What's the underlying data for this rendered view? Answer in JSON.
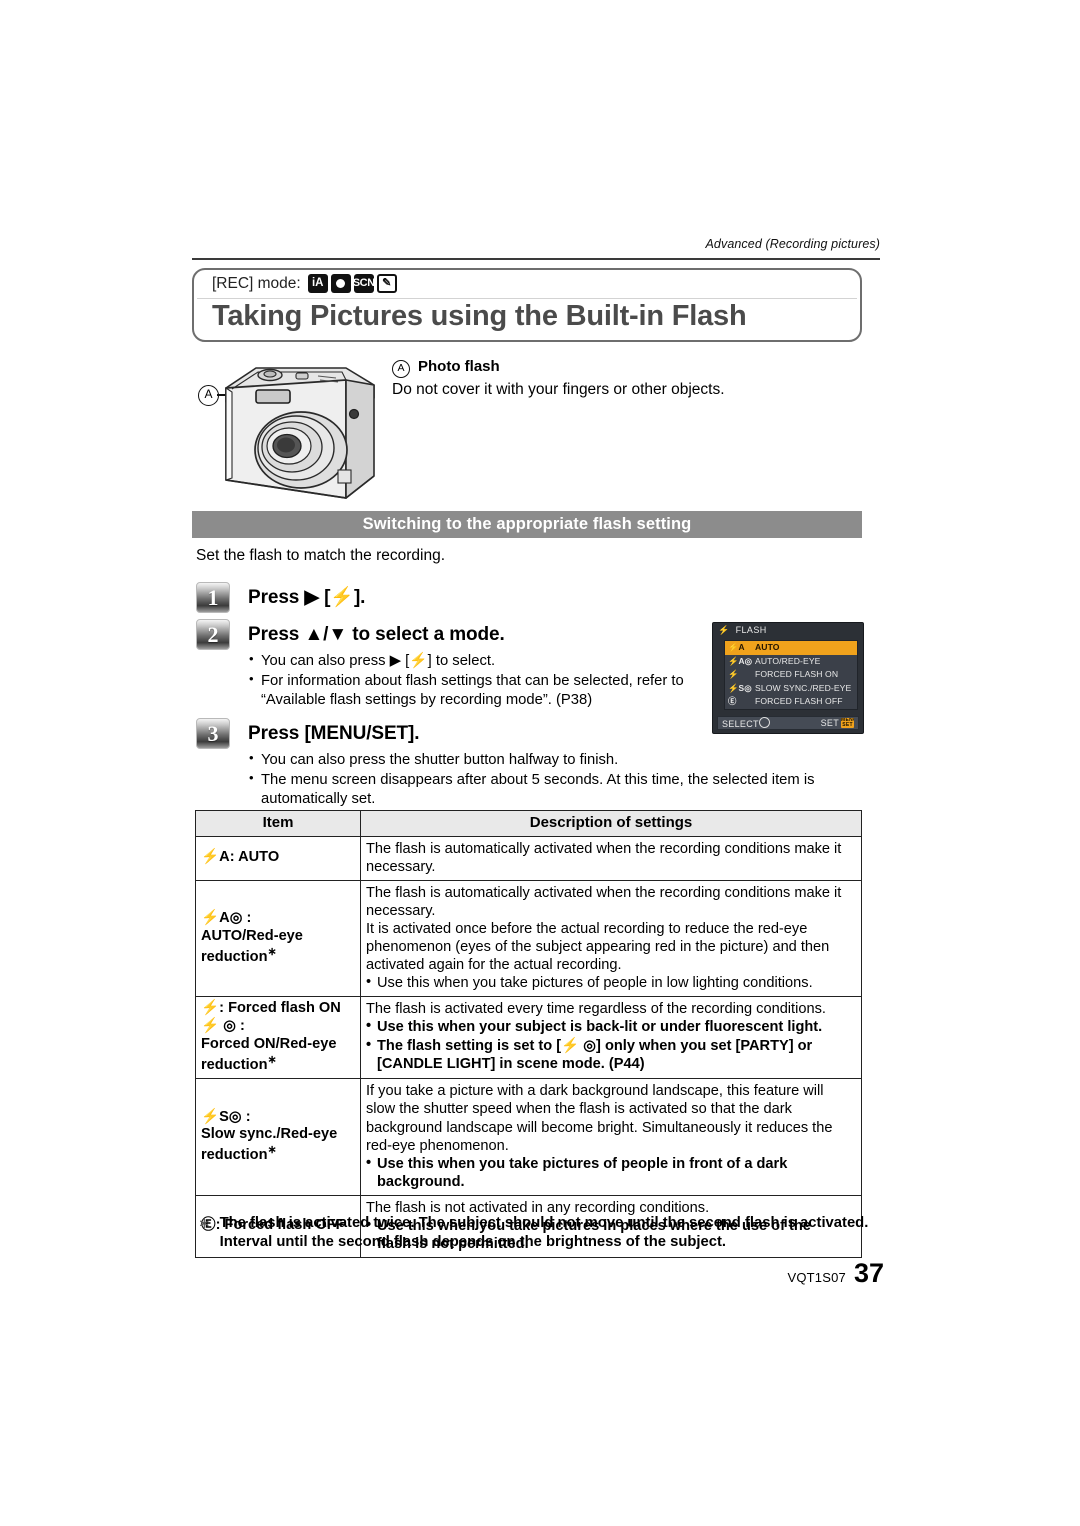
{
  "header": {
    "running_head": "Advanced (Recording pictures)",
    "rec_mode_label": "[REC] mode:",
    "rec_mode_icons": [
      "iA",
      "rec-dot",
      "SCN",
      "custom-note"
    ],
    "title": "Taking Pictures using the Built-in Flash"
  },
  "figure": {
    "callout_letter": "A",
    "caption_marker": "A",
    "caption_title": "Photo flash",
    "caption_body": "Do not cover it with your fingers or other objects."
  },
  "section": {
    "banner": "Switching to the appropriate flash setting",
    "intro": "Set the flash to match the recording."
  },
  "steps": [
    {
      "number": "1",
      "title_pre": "Press ▶ [",
      "title_glyph": "⚡",
      "title_post": "].",
      "bullets": []
    },
    {
      "number": "2",
      "title_pre": "Press ▲/▼ to select a mode.",
      "title_glyph": "",
      "title_post": "",
      "bullets": [
        "You can also press ▶ [⚡] to select.",
        "For information about flash settings that can be selected, refer to",
        "“Available flash settings by recording mode”. (P38)"
      ]
    },
    {
      "number": "3",
      "title_pre": "Press [MENU/SET].",
      "title_glyph": "",
      "title_post": "",
      "bullets": [
        "You can also press the shutter button halfway to finish.",
        "The menu screen disappears after about 5 seconds. At this time, the selected item is",
        "automatically set."
      ]
    }
  ],
  "lcd": {
    "title": "FLASH",
    "title_icon": "⚡",
    "rows": [
      {
        "icon": "⚡A",
        "label": "AUTO",
        "selected": true
      },
      {
        "icon": "⚡A◎",
        "label": "AUTO/RED-EYE",
        "selected": false
      },
      {
        "icon": "⚡",
        "label": "FORCED FLASH ON",
        "selected": false
      },
      {
        "icon": "⚡S◎",
        "label": "SLOW SYNC./RED-EYE",
        "selected": false
      },
      {
        "icon": "Ⓔ",
        "label": "FORCED FLASH OFF",
        "selected": false
      }
    ],
    "footer_left": "SELECT",
    "footer_right": "SET",
    "footer_chip": "MENU SET",
    "highlight_color": "#f0a21c",
    "background_color": "#2c3036"
  },
  "table": {
    "headers": [
      "Item",
      "Description of settings"
    ],
    "rows": [
      {
        "item_icon": "⚡A",
        "item_text": ": AUTO",
        "item_lines": [],
        "item_star": false,
        "desc": [
          {
            "type": "p",
            "text": "The flash is automatically activated when the recording conditions make it necessary."
          }
        ]
      },
      {
        "item_icon": "⚡A◎",
        "item_text": " :",
        "item_lines": [
          "AUTO/Red-eye",
          "reduction"
        ],
        "item_star": true,
        "desc": [
          {
            "type": "p",
            "text": "The flash is automatically activated when the recording conditions make it necessary."
          },
          {
            "type": "p",
            "text": "It is activated once before the actual recording to reduce the red-eye phenomenon (eyes of the subject appearing red in the picture) and then activated again for the actual recording."
          },
          {
            "type": "b2",
            "text": "Use this when you take pictures of people in low lighting conditions."
          }
        ]
      },
      {
        "item_icon": "⚡",
        "item_text": ": Forced flash ON",
        "item_lines": [
          "⚡ ◎ :",
          "Forced ON/Red-eye",
          "reduction"
        ],
        "item_star": true,
        "desc": [
          {
            "type": "p",
            "text": "The flash is activated every time regardless of the recording conditions."
          },
          {
            "type": "b",
            "text": "Use this when your subject is back-lit or under fluorescent light."
          },
          {
            "type": "b",
            "text": "The flash setting is set to [⚡ ◎] only when you set [PARTY] or"
          },
          {
            "type": "ind",
            "text": "[CANDLE LIGHT] in scene mode. (P44)"
          }
        ]
      },
      {
        "item_icon": "⚡S◎",
        "item_text": " :",
        "item_lines": [
          "Slow sync./Red-eye",
          "reduction"
        ],
        "item_star": true,
        "desc": [
          {
            "type": "p",
            "text": "If you take a picture with a dark background landscape, this feature will slow the shutter speed when the flash is activated so that the dark background landscape will become bright. Simultaneously it reduces the red-eye phenomenon."
          },
          {
            "type": "b",
            "text": "Use this when you take pictures of people in front of a dark"
          },
          {
            "type": "ind",
            "text": "background."
          }
        ]
      },
      {
        "item_icon": "Ⓔ",
        "item_text": ": Forced flash OFF",
        "item_lines": [],
        "item_star": false,
        "desc": [
          {
            "type": "p",
            "text": "The flash is not activated in any recording conditions."
          },
          {
            "type": "b",
            "text": "Use this when you take pictures in places where the use of the"
          },
          {
            "type": "ind",
            "text": "flash is not permitted."
          }
        ]
      }
    ]
  },
  "footnote": {
    "mark": "※",
    "text": "The flash is activated twice. The subject should not move until the second flash is activated. Interval until the second flash depends on the brightness of the subject."
  },
  "footer": {
    "doc_code": "VQT1S07",
    "page_number": "37"
  }
}
